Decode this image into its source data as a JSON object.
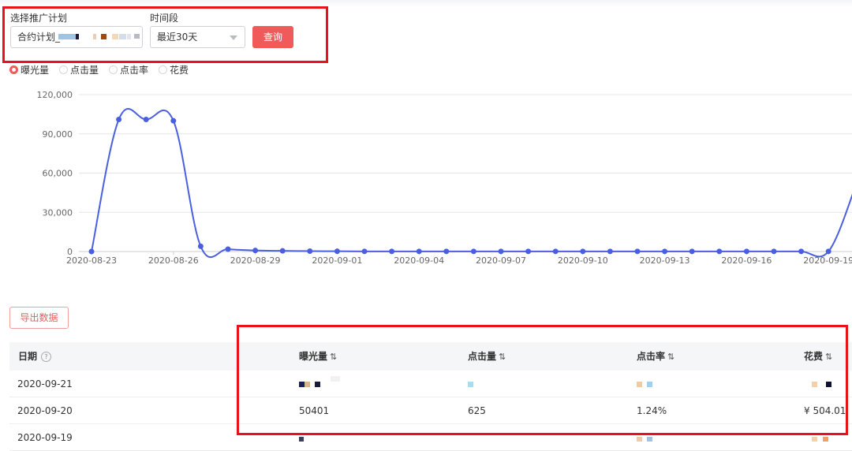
{
  "filters": {
    "plan_label": "选择推广计划",
    "plan_value": "合约计划_",
    "time_label": "时间段",
    "time_value": "最近30天",
    "query_button": "查询"
  },
  "metric_radios": [
    {
      "label": "曝光量",
      "checked": true
    },
    {
      "label": "点击量",
      "checked": false
    },
    {
      "label": "点击率",
      "checked": false
    },
    {
      "label": "花费",
      "checked": false
    }
  ],
  "chart_data": {
    "type": "line",
    "y_ticks": [
      "0",
      "30,000",
      "60,000",
      "90,000",
      "120,000"
    ],
    "ylim": [
      0,
      120000
    ],
    "x_tick_labels": [
      "2020-08-23",
      "2020-08-26",
      "2020-08-29",
      "2020-09-01",
      "2020-09-04",
      "2020-09-07",
      "2020-09-10",
      "2020-09-13",
      "2020-09-16",
      "2020-09-19"
    ],
    "x": [
      "2020-08-23",
      "2020-08-24",
      "2020-08-25",
      "2020-08-26",
      "2020-08-27",
      "2020-08-28",
      "2020-08-29",
      "2020-08-30",
      "2020-08-31",
      "2020-09-01",
      "2020-09-02",
      "2020-09-03",
      "2020-09-04",
      "2020-09-05",
      "2020-09-06",
      "2020-09-07",
      "2020-09-08",
      "2020-09-09",
      "2020-09-10",
      "2020-09-11",
      "2020-09-12",
      "2020-09-13",
      "2020-09-14",
      "2020-09-15",
      "2020-09-16",
      "2020-09-17",
      "2020-09-18",
      "2020-09-19",
      "2020-09-20"
    ],
    "values": [
      0,
      101000,
      101000,
      100000,
      4000,
      1800,
      800,
      500,
      300,
      200,
      100,
      100,
      100,
      100,
      100,
      100,
      100,
      100,
      100,
      100,
      100,
      100,
      100,
      100,
      100,
      100,
      100,
      100,
      50401
    ],
    "grid": true,
    "line_color": "#4a5fe0"
  },
  "export_button": "导出数据",
  "table": {
    "headers": {
      "date": "日期",
      "impressions": "曝光量",
      "clicks": "点击量",
      "ctr": "点击率",
      "cost": "花费"
    },
    "sort_icon": "⇅",
    "rows": [
      {
        "date": "2020-09-21",
        "impressions": "",
        "clicks": "",
        "ctr": "",
        "cost": ""
      },
      {
        "date": "2020-09-20",
        "impressions": "50401",
        "clicks": "625",
        "ctr": "1.24%",
        "cost": "¥ 504.01"
      },
      {
        "date": "2020-09-19",
        "impressions": "",
        "clicks": "",
        "ctr": "",
        "cost": ""
      }
    ]
  },
  "colors": {
    "accent": "#f05a5a",
    "annotation": "#e8121a",
    "line": "#4a5fe0"
  }
}
